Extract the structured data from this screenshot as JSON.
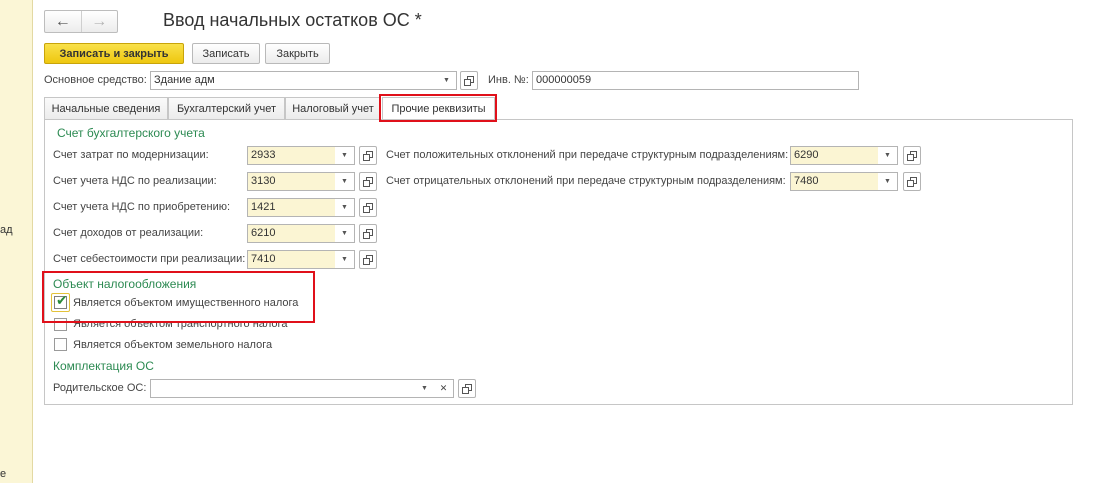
{
  "left_panel": {
    "fragment_1": "ад",
    "fragment_2": "е"
  },
  "nav": {
    "back": "←",
    "forward": "→"
  },
  "window": {
    "title": "Ввод начальных остатков ОС *"
  },
  "toolbar": {
    "save_close_label": "Записать и закрыть",
    "save_label": "Записать",
    "close_label": "Закрыть"
  },
  "header": {
    "asset_label": "Основное средство:",
    "asset_value": "Здание адм",
    "inv_label": "Инв. №:",
    "inv_value": "000000059"
  },
  "tabs": [
    {
      "label": "Начальные сведения"
    },
    {
      "label": "Бухгалтерский учет"
    },
    {
      "label": "Налоговый учет"
    },
    {
      "label": "Прочие реквизиты",
      "active": true
    }
  ],
  "accounting": {
    "group_title": "Счет бухгалтерского учета",
    "modernization_label": "Счет затрат по модернизации:",
    "modernization_value": "2933",
    "vat_sale_label": "Счет учета НДС по реализации:",
    "vat_sale_value": "3130",
    "vat_purchase_label": "Счет учета НДС по приобретению:",
    "vat_purchase_value": "1421",
    "income_label": "Счет доходов от реализации:",
    "income_value": "6210",
    "cost_label": "Счет себестоимости при реализации:",
    "cost_value": "7410",
    "positive_dev_label": "Счет положительных отклонений при передаче структурным подразделениям:",
    "positive_dev_value": "6290",
    "negative_dev_label": "Счет отрицательных отклонений при передаче структурным подразделениям:",
    "negative_dev_value": "7480"
  },
  "taxation": {
    "group_title": "Объект налогообложения",
    "property_tax_label": "Является объектом имущественного налога",
    "property_tax_checked": true,
    "transport_tax_label": "Является объектом транспортного налога",
    "transport_tax_checked": false,
    "land_tax_label": "Является объектом земельного налога",
    "land_tax_checked": false
  },
  "kit": {
    "group_title": "Комплектация ОС",
    "parent_label": "Родительское ОС:",
    "parent_value": ""
  },
  "colors": {
    "accent_green": "#2c8a52",
    "primary_button": "#f2cf1d",
    "highlight_red": "#e0101a",
    "field_yellow": "#fbf5d3"
  },
  "icons": {
    "back": "arrow-left-icon",
    "forward": "arrow-right-icon",
    "dropdown": "triangle-down-icon",
    "open": "open-window-icon",
    "clear": "clear-x-icon",
    "check": "checkmark-icon"
  }
}
